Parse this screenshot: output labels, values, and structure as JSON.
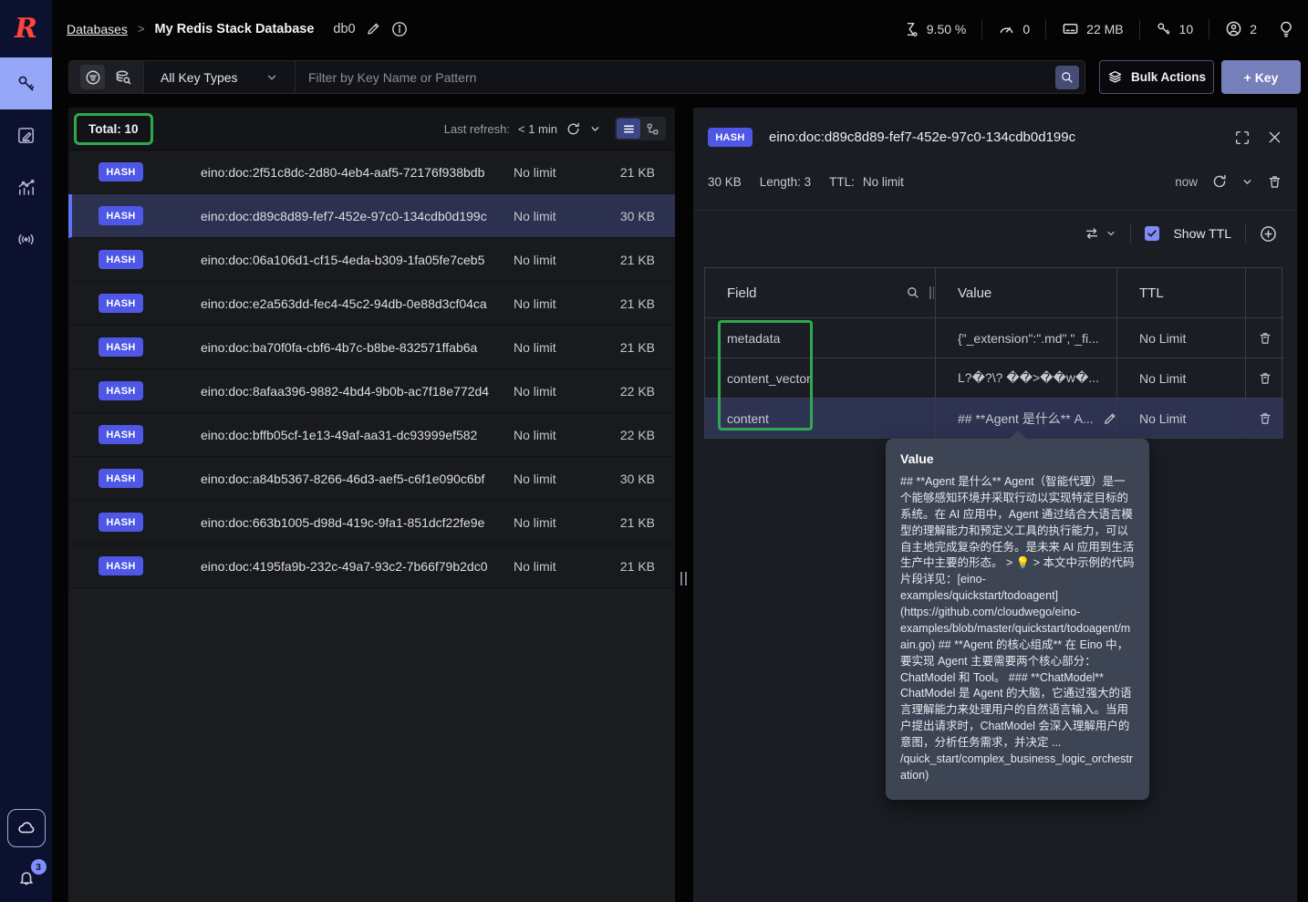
{
  "sidebar": {
    "notifications_badge": "3"
  },
  "header": {
    "breadcrumb_root": "Databases",
    "breadcrumb_separator": ">",
    "database_name": "My Redis Stack Database",
    "db_index": "db0",
    "stats": {
      "cpu": "9.50 %",
      "commands": "0",
      "memory": "22 MB",
      "keys": "10",
      "clients": "2"
    }
  },
  "filter_bar": {
    "key_type_selected": "All Key Types",
    "search_placeholder": "Filter by Key Name or Pattern",
    "bulk_actions_label": "Bulk Actions",
    "add_key_label": "+ Key"
  },
  "key_list": {
    "total_label": "Total: 10",
    "last_refresh_label": "Last refresh:",
    "last_refresh_value": "< 1 min",
    "rows": [
      {
        "type": "HASH",
        "name": "eino:doc:2f51c8dc-2d80-4eb4-aaf5-72176f938bdb",
        "ttl": "No limit",
        "size": "21 KB"
      },
      {
        "type": "HASH",
        "name": "eino:doc:d89c8d89-fef7-452e-97c0-134cdb0d199c",
        "ttl": "No limit",
        "size": "30 KB"
      },
      {
        "type": "HASH",
        "name": "eino:doc:06a106d1-cf15-4eda-b309-1fa05fe7ceb5",
        "ttl": "No limit",
        "size": "21 KB"
      },
      {
        "type": "HASH",
        "name": "eino:doc:e2a563dd-fec4-45c2-94db-0e88d3cf04ca",
        "ttl": "No limit",
        "size": "21 KB"
      },
      {
        "type": "HASH",
        "name": "eino:doc:ba70f0fa-cbf6-4b7c-b8be-832571ffab6a",
        "ttl": "No limit",
        "size": "21 KB"
      },
      {
        "type": "HASH",
        "name": "eino:doc:8afaa396-9882-4bd4-9b0b-ac7f18e772d4",
        "ttl": "No limit",
        "size": "22 KB"
      },
      {
        "type": "HASH",
        "name": "eino:doc:bffb05cf-1e13-49af-aa31-dc93999ef582",
        "ttl": "No limit",
        "size": "22 KB"
      },
      {
        "type": "HASH",
        "name": "eino:doc:a84b5367-8266-46d3-aef5-c6f1e090c6bf",
        "ttl": "No limit",
        "size": "30 KB"
      },
      {
        "type": "HASH",
        "name": "eino:doc:663b1005-d98d-419c-9fa1-851dcf22fe9e",
        "ttl": "No limit",
        "size": "21 KB"
      },
      {
        "type": "HASH",
        "name": "eino:doc:4195fa9b-232c-49a7-93c2-7b66f79b2dc0",
        "ttl": "No limit",
        "size": "21 KB"
      }
    ]
  },
  "details": {
    "type_badge": "HASH",
    "key_name": "eino:doc:d89c8d89-fef7-452e-97c0-134cdb0d199c",
    "size": "30 KB",
    "length": "Length: 3",
    "ttl_label": "TTL:",
    "ttl_value": "No limit",
    "refreshed": "now",
    "show_ttl_label": "Show TTL",
    "table": {
      "field_header": "Field",
      "value_header": "Value",
      "ttl_header": "TTL",
      "rows": [
        {
          "field": "metadata",
          "value": "{\"_extension\":\".md\",\"_fi...",
          "ttl": "No Limit"
        },
        {
          "field": "content_vector",
          "value": "L?�?\\? ��>��w�...",
          "ttl": "No Limit"
        },
        {
          "field": "content",
          "value": "## **Agent 是什么** A...",
          "ttl": "No Limit"
        }
      ]
    },
    "tooltip": {
      "title": "Value",
      "text": "## **Agent 是什么** Agent（智能代理）是一个能够感知环境并采取行动以实现特定目标的系统。在 AI 应用中，Agent 通过结合大语言模型的理解能力和预定义工具的执行能力，可以自主地完成复杂的任务。是未来 AI 应用到生活生产中主要的形态。 > 💡 > 本文中示例的代码片段详见：[eino-examples/quickstart/todoagent](https://github.com/cloudwego/eino-examples/blob/master/quickstart/todoagent/main.go) ## **Agent 的核心组成** 在 Eino 中，要实现 Agent 主要需要两个核心部分：ChatModel 和 Tool。 ### **ChatModel** ChatModel 是 Agent 的大脑，它通过强大的语言理解能力来处理用户的自然语言输入。当用户提出请求时，ChatModel 会深入理解用户的意图，分析任务需求，并决定 ... /quick_start/complex_business_logic_orchestration)"
    }
  },
  "colors": {
    "accent_green": "#2fa84f",
    "badge_blue": "#4f58e6",
    "active_nav_blue": "#97a7f7",
    "selected_row": "#2c3150",
    "primary_button": "#757fba",
    "redis_red": "#ff4438",
    "sidebar_navy": "#0d1130"
  }
}
